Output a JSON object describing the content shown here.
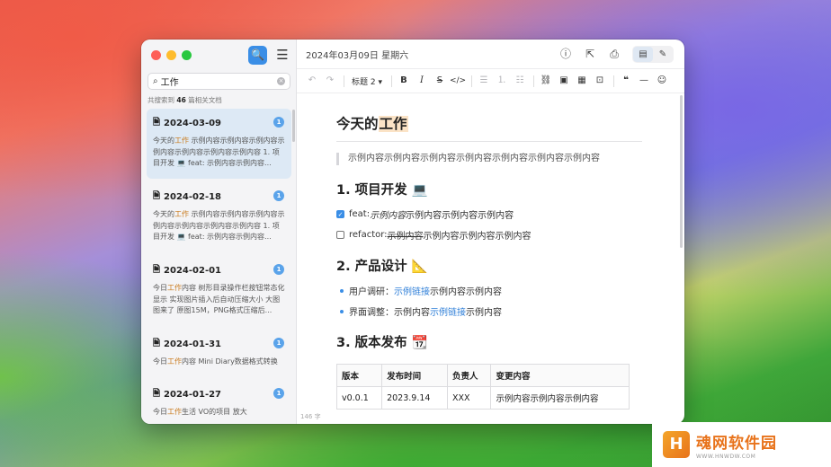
{
  "window": {
    "date": "2024年03月09日 星期六"
  },
  "search": {
    "value": "工作",
    "result_prefix": "共搜索到 ",
    "result_count": "46",
    "result_suffix": " 篇相关文档"
  },
  "docs": [
    {
      "date": "2024-03-09",
      "badge": "1",
      "pre": "今天的",
      "hl": "工作",
      "post": " 示例内容示例内容示例内容示例内容示例内容示例内容示例内容 1. 项目开发 💻 feat: 示例内容示例内容..."
    },
    {
      "date": "2024-02-18",
      "badge": "1",
      "pre": "今天的",
      "hl": "工作",
      "post": " 示例内容示例内容示例内容示例内容示例内容示例内容示例内容 1. 项目开发 💻 feat: 示例内容示例内容..."
    },
    {
      "date": "2024-02-01",
      "badge": "1",
      "pre": "今日",
      "hl": "工作",
      "post": "内容 树形目录操作栏按钮常态化显示 实现图片插入后自动压缩大小 大图图来了 原图15M，PNG格式压缩后..."
    },
    {
      "date": "2024-01-31",
      "badge": "1",
      "pre": "今日",
      "hl": "工作",
      "post": "内容 Mini Diary数据格式转换"
    },
    {
      "date": "2024-01-27",
      "badge": "1",
      "pre": "今日",
      "hl": "工作",
      "post": "生活 VO的项目 放大"
    }
  ],
  "toolbar": {
    "heading_label": "标题 2 ▾"
  },
  "content": {
    "title_pre": "今天的",
    "title_hl": "工作",
    "quote": "示例内容示例内容示例内容示例内容示例内容示例内容示例内容",
    "section1": "1. 项目开发 💻",
    "task1_label": "feat: ",
    "task1_italic": "示例内容",
    "task1_rest": "示例内容示例内容示例内容",
    "task2_label": "refactor: ",
    "task2_strike": "示例内容",
    "task2_rest": "示例内容示例内容示例内容",
    "section2": "2. 产品设计 📐",
    "bullet1_pre": "用户调研：",
    "bullet1_link": "示例链接",
    "bullet1_post": "示例内容示例内容",
    "bullet2_pre": "界面调整：示例内容",
    "bullet2_link": "示例链接",
    "bullet2_post": "示例内容",
    "section3": "3. 版本发布 📆",
    "table": {
      "headers": [
        "版本",
        "发布时间",
        "负责人",
        "变更内容"
      ],
      "row": [
        "v0.0.1",
        "2023.9.14",
        "XXX",
        "示例内容示例内容示例内容"
      ]
    }
  },
  "word_count": "146 字",
  "watermark": {
    "logo": "H",
    "title": "魂网软件园",
    "url": "WWW.HNWDW.COM"
  },
  "icons": {
    "search": "🔍",
    "menu": "☰",
    "info": "ⓘ",
    "export": "⇱",
    "print": "⎙",
    "read_mode": "▤",
    "edit_mode": "✎",
    "file": "🗎",
    "mag": "⌕",
    "clear": "×",
    "check": "✓"
  }
}
